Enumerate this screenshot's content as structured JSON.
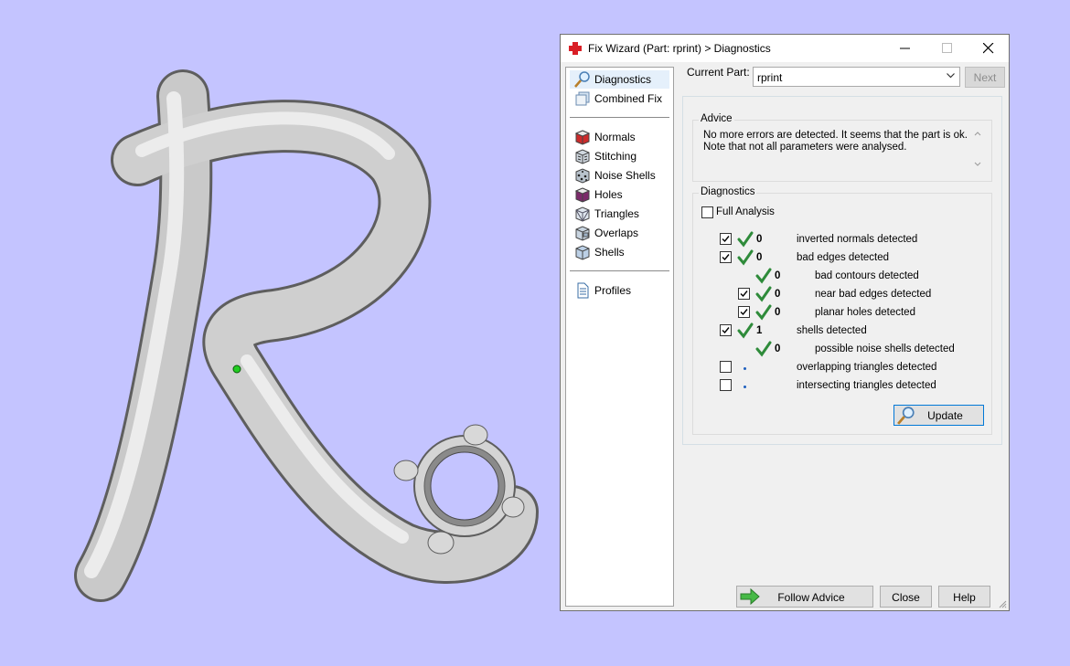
{
  "window": {
    "title": "Fix Wizard (Part: rprint) > Diagnostics"
  },
  "nav": {
    "items": [
      {
        "label": "Diagnostics",
        "icon": "magnifier-icon"
      },
      {
        "label": "Combined Fix",
        "icon": "combined-fix-icon"
      },
      {
        "label": "Normals",
        "icon": "normals-cube-icon"
      },
      {
        "label": "Stitching",
        "icon": "stitching-cube-icon"
      },
      {
        "label": "Noise Shells",
        "icon": "noise-shells-cube-icon"
      },
      {
        "label": "Holes",
        "icon": "holes-cube-icon"
      },
      {
        "label": "Triangles",
        "icon": "triangles-cube-icon"
      },
      {
        "label": "Overlaps",
        "icon": "overlaps-cube-icon"
      },
      {
        "label": "Shells",
        "icon": "shells-cube-icon"
      },
      {
        "label": "Profiles",
        "icon": "profiles-document-icon"
      }
    ],
    "selected": "Diagnostics"
  },
  "current_part": {
    "label": "Current Part:",
    "value": "rprint",
    "next_label": "Next"
  },
  "advice": {
    "legend": "Advice",
    "text": "No more errors are detected. It seems that the part is ok. Note that not all parameters were analysed."
  },
  "diagnostics": {
    "legend": "Diagnostics",
    "full_analysis_label": "Full Analysis",
    "full_analysis_checked": false,
    "rows": [
      {
        "checkbox": true,
        "checked": true,
        "ok": true,
        "count": "0",
        "label": "inverted normals detected"
      },
      {
        "checkbox": true,
        "checked": true,
        "ok": true,
        "count": "0",
        "label": "bad edges detected"
      },
      {
        "checkbox": false,
        "checked": false,
        "ok": true,
        "count": "0",
        "label": "bad contours detected"
      },
      {
        "checkbox": true,
        "checked": true,
        "ok": true,
        "count": "0",
        "label": "near bad edges detected"
      },
      {
        "checkbox": true,
        "checked": true,
        "ok": true,
        "count": "0",
        "label": "planar holes detected"
      },
      {
        "checkbox": true,
        "checked": true,
        "ok": true,
        "count": "1",
        "label": "shells detected"
      },
      {
        "checkbox": false,
        "checked": false,
        "ok": true,
        "count": "0",
        "label": "possible noise shells detected"
      },
      {
        "checkbox": true,
        "checked": false,
        "ok": false,
        "count": "",
        "label": "overlapping triangles detected"
      },
      {
        "checkbox": true,
        "checked": false,
        "ok": false,
        "count": "",
        "label": "intersecting triangles detected"
      }
    ],
    "update_label": "Update"
  },
  "footer": {
    "follow_advice_label": "Follow Advice",
    "close_label": "Close",
    "help_label": "Help"
  },
  "colors": {
    "background": "#c4c4ff",
    "ok_check": "#2e8b3a",
    "window_bg": "#f0f0f0"
  }
}
